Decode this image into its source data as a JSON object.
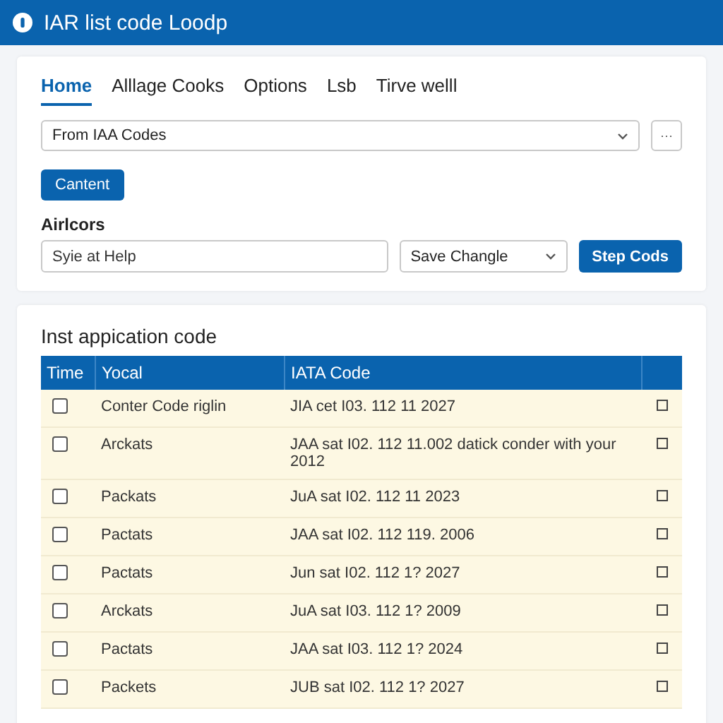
{
  "window": {
    "title": "IAR list code Loodp"
  },
  "tabs": [
    {
      "label": "Home",
      "selected": true
    },
    {
      "label": "Alllage Cooks",
      "selected": false
    },
    {
      "label": "Options",
      "selected": false
    },
    {
      "label": "Lsb",
      "selected": false
    },
    {
      "label": "Tirve welll",
      "selected": false
    }
  ],
  "source_select": {
    "value": "From IAA Codes"
  },
  "more_button": {
    "label": "···"
  },
  "primary_button": {
    "label": "Cantent"
  },
  "filter": {
    "label": "Airlcors",
    "search_value": "Syie at Help",
    "select_value": "Save Changle",
    "button": "Step Cods"
  },
  "table": {
    "title": "Inst appication code",
    "columns": [
      "Time",
      "Yocal",
      "IATA Code"
    ],
    "rows": [
      {
        "checked": false,
        "name": "Conter Code riglin",
        "code": "JIA cet I03. 112 11 2027",
        "flagged": false
      },
      {
        "checked": false,
        "name": "Arckats",
        "code": "JAA sat I02. 112 11.002 datick conder with your 2012",
        "flagged": false
      },
      {
        "checked": false,
        "name": "Packats",
        "code": "JuA sat I02. 112 11 2023",
        "flagged": false
      },
      {
        "checked": false,
        "name": "Pactats",
        "code": "JAA sat I02. 112 119. 2006",
        "flagged": false
      },
      {
        "checked": false,
        "name": "Pactats",
        "code": "Jun sat I02. 112 1? 2027",
        "flagged": false
      },
      {
        "checked": false,
        "name": "Arckats",
        "code": "JuA sat I03. 112 1? 2009",
        "flagged": false
      },
      {
        "checked": false,
        "name": "Pactats",
        "code": "JAA sat I03. 112 1? 2024",
        "flagged": false
      },
      {
        "checked": false,
        "name": "Packets",
        "code": "JUB sat I02. 112 1? 2027",
        "flagged": false
      }
    ]
  }
}
